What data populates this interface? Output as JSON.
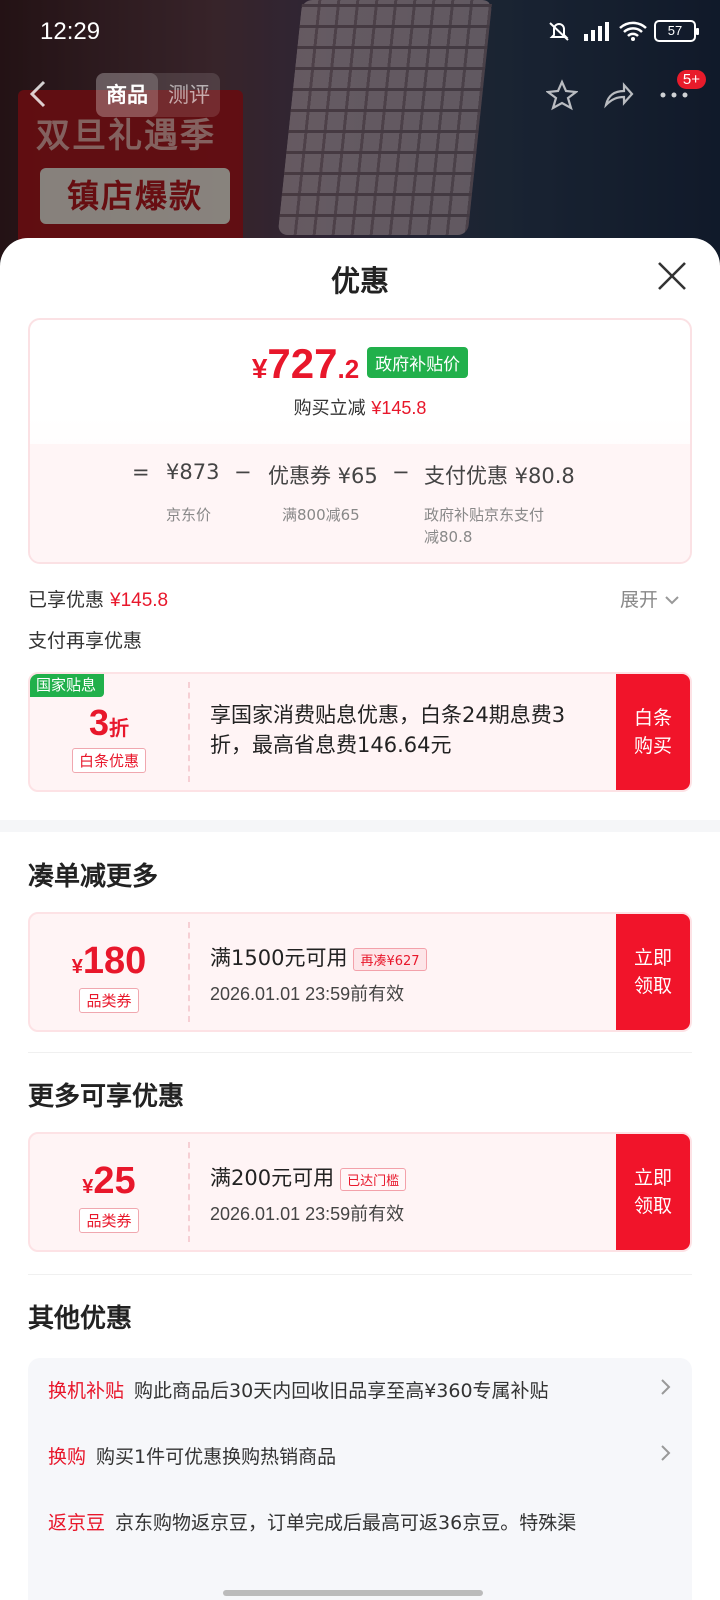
{
  "status_bar": {
    "time": "12:29",
    "battery": "57"
  },
  "nav": {
    "tabs": [
      {
        "label": "商品",
        "active": true
      },
      {
        "label": "测评",
        "active": false
      }
    ],
    "badge": "5+"
  },
  "background": {
    "banner_line1": "双旦礼遇季",
    "banner_line2": "镇店爆款"
  },
  "sheet": {
    "title": "优惠",
    "price": {
      "currency": "¥",
      "integer": "727",
      "decimal": ".2",
      "tag": "政府补贴价",
      "instant_label": "购买立减",
      "instant_value": "¥145.8"
    },
    "formula": {
      "eq": "=",
      "minus": "−",
      "jd_price": "¥873",
      "jd_label": "京东价",
      "coupon": "优惠券 ¥65",
      "coupon_label": "满800减65",
      "pay": "支付优惠 ¥80.8",
      "pay_label_1": "政府补贴京东支付",
      "pay_label_2": "减80.8"
    },
    "enjoyed_label": "已享优惠",
    "enjoyed_value": "¥145.8",
    "expand_label": "展开",
    "pay_again_label": "支付再享优惠",
    "baitiao": {
      "corner_tag": "国家贴息",
      "discount": "3",
      "discount_unit": "折",
      "tag": "白条优惠",
      "desc": "享国家消费贴息优惠，白条24期息费3折，最高省息费146.64元",
      "button": "白条购买"
    },
    "section_more": "凑单减更多",
    "coupon_180": {
      "currency": "¥",
      "amount": "180",
      "type": "品类券",
      "condition": "满1500元可用",
      "pill": "再凑¥627",
      "expire": "2026.01.01 23:59前有效",
      "button": "立即领取"
    },
    "section_enjoy": "更多可享优惠",
    "coupon_25": {
      "currency": "¥",
      "amount": "25",
      "type": "品类券",
      "condition": "满200元可用",
      "pill": "已达门槛",
      "expire": "2026.01.01 23:59前有效",
      "button": "立即领取"
    },
    "section_other": "其他优惠",
    "other": [
      {
        "label": "换机补贴",
        "text": "购此商品后30天内回收旧品享至高¥360专属补贴"
      },
      {
        "label": "换购",
        "text": "购买1件可优惠换购热销商品"
      },
      {
        "label": "返京豆",
        "text": "京东购物返京豆，订单完成后最高可返36京豆。特殊渠"
      }
    ]
  },
  "colors": {
    "accent_red": "#e8172b",
    "button_red": "#f1142a",
    "gov_green": "#21b04b"
  }
}
